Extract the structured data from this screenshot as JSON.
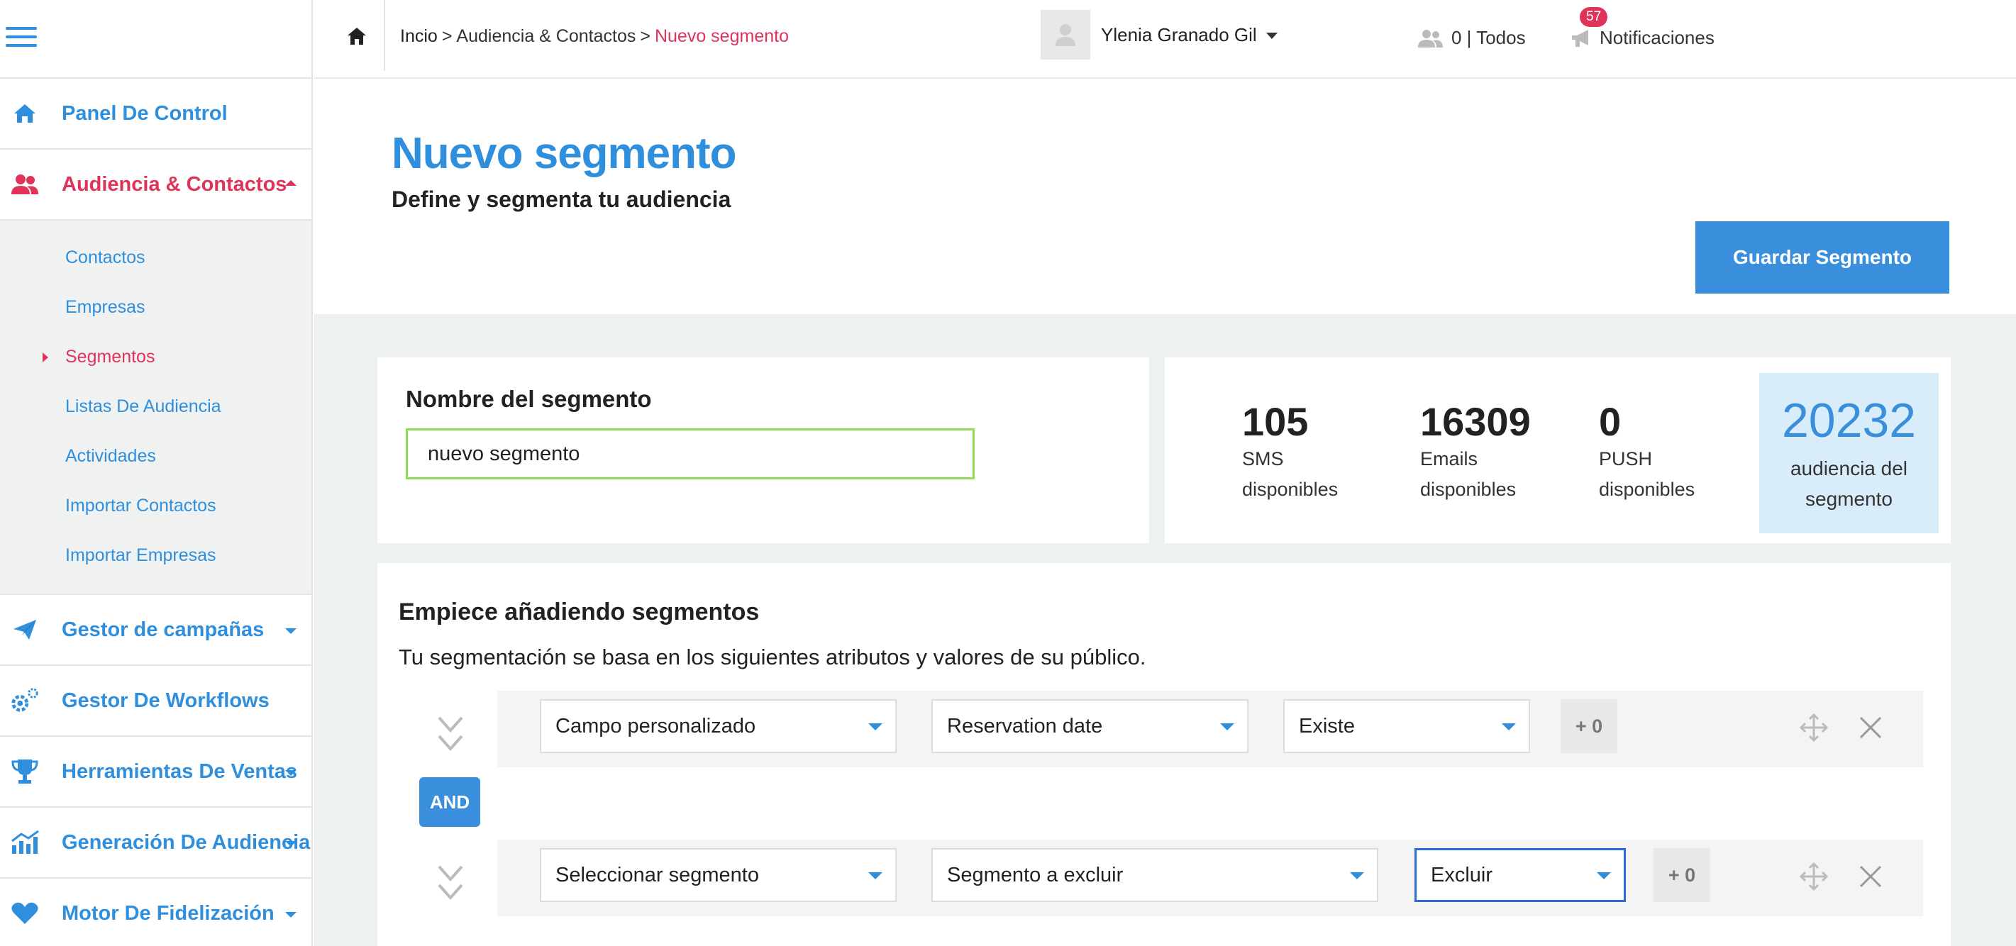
{
  "sidebar": {
    "menu_icon": "hamburger-icon",
    "items": [
      {
        "label": "Panel De Control",
        "icon": "home-icon"
      },
      {
        "label": "Audiencia & Contactos",
        "icon": "users-icon"
      },
      {
        "label": "Gestor de campañas",
        "icon": "paper-plane-icon"
      },
      {
        "label": "Gestor De Workflows",
        "icon": "gears-icon"
      },
      {
        "label": "Herramientas De Ventas",
        "icon": "trophy-icon"
      },
      {
        "label": "Generación De Audiencia",
        "icon": "chart-icon"
      },
      {
        "label": "Motor De Fidelización",
        "icon": "heart-icon"
      }
    ],
    "submenu": [
      {
        "label": "Contactos"
      },
      {
        "label": "Empresas"
      },
      {
        "label": "Segmentos"
      },
      {
        "label": "Listas De Audiencia"
      },
      {
        "label": "Actividades"
      },
      {
        "label": "Importar Contactos"
      },
      {
        "label": "Importar Empresas"
      }
    ]
  },
  "topbar": {
    "breadcrumb": {
      "home": "Incio",
      "section": "Audiencia & Contactos",
      "current": "Nuevo segmento",
      "separator": ">"
    },
    "audience_count": "0 | Todos",
    "notifications": {
      "label": "Notificaciones",
      "badge": "57"
    },
    "user": {
      "name": "Ylenia Granado Gil"
    }
  },
  "header": {
    "title": "Nuevo segmento",
    "subtitle": "Define y segmenta tu audiencia",
    "save_label": "Guardar Segmento"
  },
  "segment_name": {
    "label": "Nombre del segmento",
    "value": "nuevo segmento"
  },
  "stats": [
    {
      "value": "105",
      "label": "SMS disponibles"
    },
    {
      "value": "16309",
      "label": "Emails disponibles"
    },
    {
      "value": "0",
      "label": "PUSH disponibles"
    }
  ],
  "audience_total": {
    "value": "20232",
    "label": "audiencia del segmento"
  },
  "rules": {
    "title": "Empiece añadiendo segmentos",
    "description": "Tu segmentación se basa en los siguientes atributos y valores de su público.",
    "connector": "AND",
    "rows": [
      {
        "field": "Campo personalizado",
        "attribute": "Reservation date",
        "operator": "Existe",
        "extra": "+ 0"
      },
      {
        "field": "Seleccionar segmento",
        "attribute": "Segmento a excluir",
        "operator": "Excluir",
        "extra": "+ 0"
      }
    ]
  },
  "colors": {
    "accent": "#2f8fdc",
    "active": "#e0335a",
    "highlight_bg": "#d9ecfa",
    "input_valid": "#8fdc5b"
  }
}
